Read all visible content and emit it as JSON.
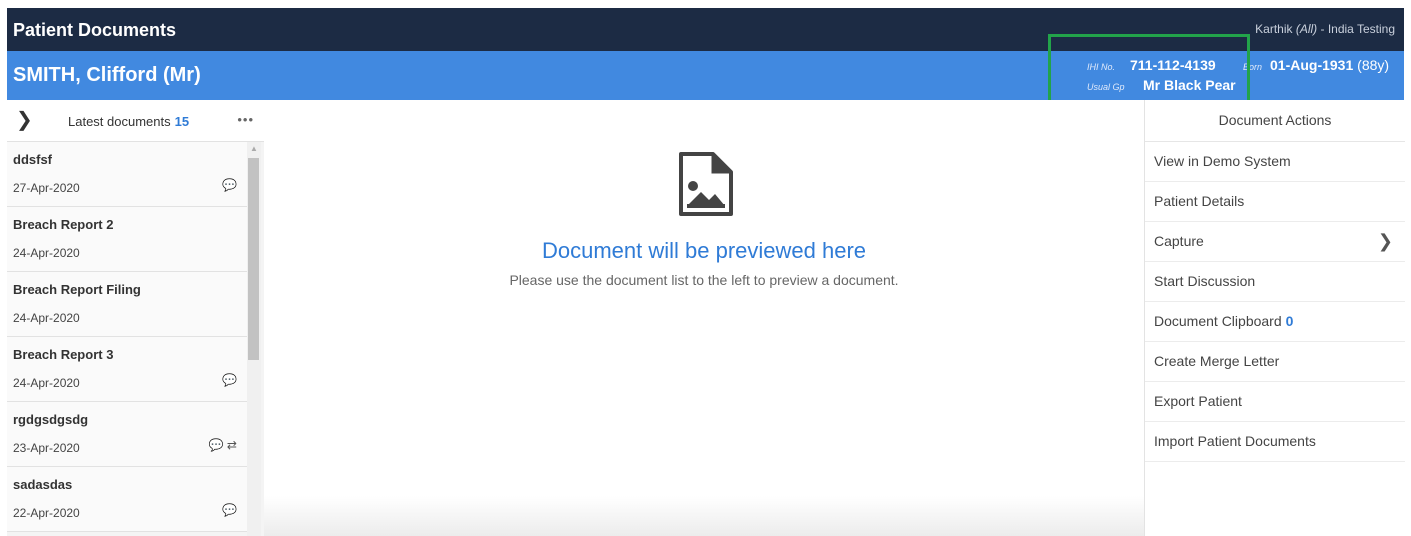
{
  "header": {
    "title": "Patient Documents",
    "user": "Karthik",
    "user_scope": "(All)",
    "user_org": " - India Testing"
  },
  "patient": {
    "name": "SMITH, Clifford (Mr)",
    "ihi_label": "IHI No.",
    "ihi": "711-112-4139",
    "born_label": "Born",
    "dob": "01-Aug-1931",
    "age": "(88y)",
    "gp_label": "Usual Gp",
    "gp": "Mr Black Pear"
  },
  "documents": {
    "title": "Latest documents",
    "count": "15",
    "items": [
      {
        "name": "ddsfsf",
        "date": "27-Apr-2020",
        "icons": "💬"
      },
      {
        "name": "Breach Report 2",
        "date": "24-Apr-2020",
        "icons": ""
      },
      {
        "name": "Breach Report Filing",
        "date": "24-Apr-2020",
        "icons": ""
      },
      {
        "name": "Breach Report 3",
        "date": "24-Apr-2020",
        "icons": "💬"
      },
      {
        "name": "rgdgsdgsdg",
        "date": "23-Apr-2020",
        "icons": "💬 ⇄"
      },
      {
        "name": "sadasdas",
        "date": "22-Apr-2020",
        "icons": "💬"
      }
    ]
  },
  "preview": {
    "title": "Document will be previewed here",
    "subtitle": "Please use the document list to the left to preview a document."
  },
  "actions": {
    "title": "Document Actions",
    "view_demo": "View in Demo System",
    "patient_details": "Patient Details",
    "capture": "Capture",
    "start_discussion": "Start Discussion",
    "clipboard": "Document Clipboard",
    "clipboard_count": "0",
    "merge_letter": "Create Merge Letter",
    "export": "Export Patient",
    "import": "Import Patient Documents"
  },
  "colors": {
    "header_bg": "#1c2b44",
    "patient_bar": "#4189e0",
    "accent": "#2f7bd6",
    "highlight_box": "#22a34a"
  }
}
